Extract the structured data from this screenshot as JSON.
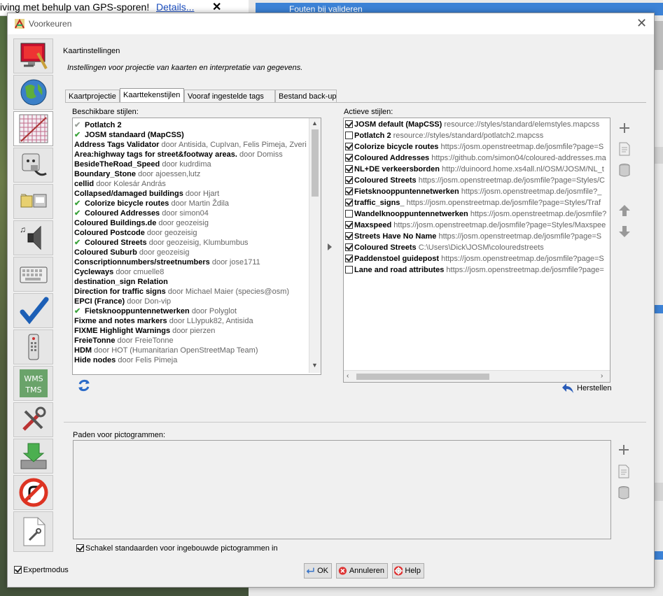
{
  "background": {
    "notification_text": "iving met behulp van GPS-sporen!",
    "notification_link": "Details...",
    "right_panel_item": "Fouten bij valideren"
  },
  "window": {
    "title": "Voorkeuren"
  },
  "header": {
    "title": "Kaartinstellingen",
    "description": "Instellingen voor projectie van kaarten en interpretatie van gegevens."
  },
  "tabs": [
    {
      "label": "Kaartprojectie",
      "active": false
    },
    {
      "label": "Kaarttekenstijlen",
      "active": true
    },
    {
      "label": "Vooraf ingestelde tags",
      "active": false
    },
    {
      "label": "Bestand back-up",
      "active": false
    }
  ],
  "available": {
    "label": "Beschikbare stijlen:",
    "items": [
      {
        "name": "Potlatch 2",
        "meta": "",
        "mark": "grey"
      },
      {
        "name": "JOSM standaard (MapCSS)",
        "meta": "",
        "mark": "green"
      },
      {
        "name": "Address Tags Validator",
        "meta": "door Antisida, CupIvan, Felis Pimeja, Zveri",
        "mark": ""
      },
      {
        "name": "Area:highway tags for street&footway areas.",
        "meta": "door Domiss",
        "mark": ""
      },
      {
        "name": "BesideTheRoad_Speed",
        "meta": "door kudrdima",
        "mark": ""
      },
      {
        "name": "Boundary_Stone",
        "meta": "door ajoessen,lutz",
        "mark": ""
      },
      {
        "name": "cellid",
        "meta": "door Kolesár András",
        "mark": ""
      },
      {
        "name": "Collapsed/damaged buildings",
        "meta": "door Hjart",
        "mark": ""
      },
      {
        "name": "Colorize bicycle routes",
        "meta": "door Martin Ždila",
        "mark": "green"
      },
      {
        "name": "Coloured Addresses",
        "meta": "door simon04",
        "mark": "green"
      },
      {
        "name": "Coloured Buildings.de",
        "meta": "door geozeisig",
        "mark": ""
      },
      {
        "name": "Coloured Postcode",
        "meta": "door geozeisig",
        "mark": ""
      },
      {
        "name": "Coloured Streets",
        "meta": "door geozeisig, Klumbumbus",
        "mark": "green"
      },
      {
        "name": "Coloured Suburb",
        "meta": "door geozeisig",
        "mark": ""
      },
      {
        "name": "Conscriptionnumbers/streetnumbers",
        "meta": "door jose1711",
        "mark": ""
      },
      {
        "name": "Cycleways",
        "meta": "door cmuelle8",
        "mark": ""
      },
      {
        "name": "destination_sign Relation",
        "meta": "",
        "mark": ""
      },
      {
        "name": "Direction for traffic signs",
        "meta": "door Michael Maier (species@osm)",
        "mark": ""
      },
      {
        "name": "EPCI (France)",
        "meta": "door Don-vip",
        "mark": ""
      },
      {
        "name": "Fietsknooppuntennetwerken",
        "meta": "door Polyglot",
        "mark": "green"
      },
      {
        "name": "Fixme and notes markers",
        "meta": "door LLlypuk82, Antisida",
        "mark": ""
      },
      {
        "name": "FIXME Highlight Warnings",
        "meta": "door pierzen",
        "mark": ""
      },
      {
        "name": "FreieTonne",
        "meta": "door FreieTonne",
        "mark": ""
      },
      {
        "name": "HDM",
        "meta": "door HOT (Humanitarian OpenStreetMap Team)",
        "mark": ""
      },
      {
        "name": "Hide nodes",
        "meta": "door Felis Pimeja",
        "mark": ""
      }
    ]
  },
  "active": {
    "label": "Actieve stijlen:",
    "items": [
      {
        "name": "JOSM default (MapCSS)",
        "url": "resource://styles/standard/elemstyles.mapcss",
        "checked": true
      },
      {
        "name": "Potlatch 2",
        "url": "resource://styles/standard/potlatch2.mapcss",
        "checked": false
      },
      {
        "name": "Colorize bicycle routes",
        "url": "https://josm.openstreetmap.de/josmfile?page=S",
        "checked": true
      },
      {
        "name": "Coloured Addresses",
        "url": "https://github.com/simon04/coloured-addresses.ma",
        "checked": true
      },
      {
        "name": "NL+DE verkeersborden",
        "url": "http://duinoord.home.xs4all.nl/OSM/JOSM/NL_t",
        "checked": true
      },
      {
        "name": "Coloured Streets",
        "url": "https://josm.openstreetmap.de/josmfile?page=Styles/C",
        "checked": true
      },
      {
        "name": "Fietsknooppuntennetwerken",
        "url": "https://josm.openstreetmap.de/josmfile?_",
        "checked": true
      },
      {
        "name": "traffic_signs_",
        "url": "https://josm.openstreetmap.de/josmfile?page=Styles/Traf",
        "checked": true
      },
      {
        "name": "Wandelknooppuntennetwerken",
        "url": "https://josm.openstreetmap.de/josmfile?",
        "checked": false
      },
      {
        "name": "Maxspeed",
        "url": "https://josm.openstreetmap.de/josmfile?page=Styles/Maxspee",
        "checked": true
      },
      {
        "name": "Streets Have No Name",
        "url": "https://josm.openstreetmap.de/josmfile?page=S",
        "checked": true
      },
      {
        "name": "Coloured Streets",
        "url": "C:\\Users\\Dick\\JOSM\\colouredstreets",
        "checked": true
      },
      {
        "name": "Paddenstoel guidepost",
        "url": "https://josm.openstreetmap.de/josmfile?page=S",
        "checked": true
      },
      {
        "name": "Lane and road attributes",
        "url": "https://josm.openstreetmap.de/josmfile?page=",
        "checked": false
      }
    ]
  },
  "restore_label": "Herstellen",
  "icon_paths": {
    "label": "Paden voor pictogrammen:"
  },
  "default_icons_checkbox": {
    "label": "Schakel standaarden voor ingebouwde pictogrammen in",
    "checked": true
  },
  "expert_mode": {
    "label": "Expertmodus",
    "checked": true
  },
  "buttons": {
    "ok": "OK",
    "cancel": "Annuleren",
    "help": "Help"
  },
  "sidebar_tabs": [
    {
      "name": "display-icon",
      "active": false
    },
    {
      "name": "globe-icon",
      "active": false
    },
    {
      "name": "map-grid-icon",
      "active": true
    },
    {
      "name": "plug-icon",
      "active": false
    },
    {
      "name": "folders-icon",
      "active": false
    },
    {
      "name": "speaker-icon",
      "active": false
    },
    {
      "name": "keyboard-icon",
      "active": false
    },
    {
      "name": "checkmark-icon",
      "active": false
    },
    {
      "name": "remote-control-icon",
      "active": false
    },
    {
      "name": "wms-tms-icon",
      "active": false
    },
    {
      "name": "tools-icon",
      "active": false
    },
    {
      "name": "download-icon",
      "active": false
    },
    {
      "name": "no-turn-icon",
      "active": false
    },
    {
      "name": "plugin-file-icon",
      "active": false
    }
  ],
  "wms_tms_text": "WMS TMS"
}
